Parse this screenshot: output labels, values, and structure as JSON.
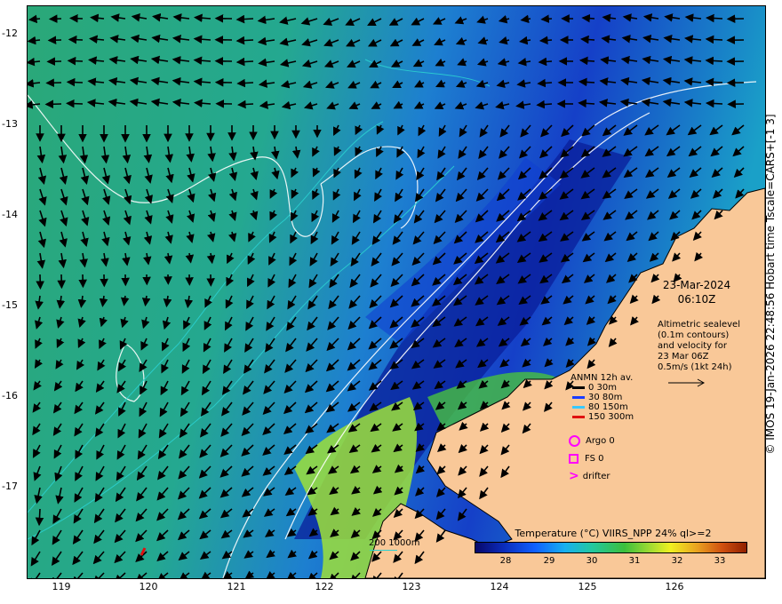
{
  "map": {
    "date": "23-Mar-2024",
    "time": "06:10Z",
    "altimetry_lines": [
      "Altimetric sealevel",
      "(0.1m contours)",
      "and velocity for",
      "23 Mar 06Z",
      "0.5m/s (1kt 24h)"
    ],
    "y_ticks": [
      "-12",
      "-13",
      "-14",
      "-15",
      "-16",
      "-17"
    ],
    "x_ticks": [
      "119",
      "120",
      "121",
      "122",
      "123",
      "124",
      "125",
      "126"
    ],
    "credit": "© IMOS 19-Jan-2026 22:48:56 Hobart time Tscale=CARS+[-1 3]",
    "scale_label": "200  1000m"
  },
  "legend": {
    "title": "ANMN 12h av.",
    "depths": [
      {
        "label": "0 30m",
        "color": "#000000"
      },
      {
        "label": "30 80m",
        "color": "#1a3cff"
      },
      {
        "label": "80 150m",
        "color": "#39c8ff"
      },
      {
        "label": "150 300m",
        "color": "#e01010"
      }
    ],
    "argo": "Argo 0",
    "fs": "FS 0",
    "drifter": "drifter",
    "marker_color": "#ff00ff"
  },
  "colorbar": {
    "title": "Temperature (°C) VIIRS_NPP 24% ql>=2",
    "ticks": [
      "28",
      "29",
      "30",
      "31",
      "32",
      "33"
    ]
  },
  "colors": {
    "land": "#f9c898",
    "sea_warm": "#2bb0a0",
    "sea_cool": "#0a2ab8",
    "contour": "#ffffff",
    "isobath": "#2bd0d0"
  }
}
